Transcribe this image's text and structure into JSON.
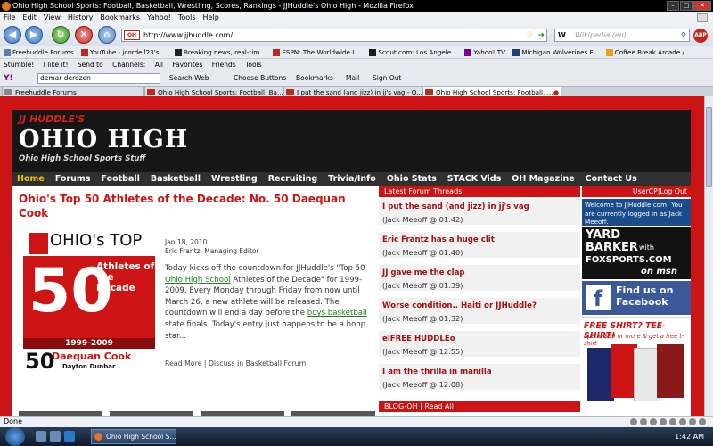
{
  "window": {
    "title": "Ohio High School Sports: Football, Basketball, Wrestling, Scores, Rankings - JJHuddle's Ohio High - Mozilla Firefox"
  },
  "menu": {
    "items": [
      "File",
      "Edit",
      "View",
      "History",
      "Bookmarks",
      "Yahoo!",
      "Tools",
      "Help"
    ]
  },
  "nav": {
    "url": "http://www.jjhuddle.com/",
    "search_placeholder": "Wikipedia (en)",
    "search_engine": "W",
    "abp_label": "ABP"
  },
  "bookmarks": [
    "Freehuddle Forums",
    "YouTube - jcordell23's ...",
    "Breaking news, real-tim...",
    "ESPN: The Worldwide L...",
    "Scout.com: Los Angele...",
    "Yahoo! TV",
    "Michigan Wolverines F...",
    "Coffee Break Arcade / ..."
  ],
  "stumble": {
    "items": [
      "Stumble!",
      "I like it!",
      "Send to",
      "Channels:",
      "All",
      "Favorites",
      "Friends",
      "Tools"
    ]
  },
  "yahoo": {
    "logo": "Y!",
    "query": "demar derozen",
    "search_web": "Search Web",
    "choose_buttons": "Choose Buttons",
    "bookmarks": "Bookmarks",
    "mail": "Mail",
    "sign_out": "Sign Out"
  },
  "tabs": [
    {
      "label": "Freehuddle Forums",
      "active": false
    },
    {
      "label": "Ohio High School Sports: Football, Ba...",
      "active": false
    },
    {
      "label": "I put the sand (and jizz) in jj's vag - O...",
      "active": false
    },
    {
      "label": "Ohio High School Sports: Football, ...",
      "active": true
    }
  ],
  "site": {
    "brand_top": "JJ HUDDLE'S",
    "brand_main": "OHIO HIGH",
    "brand_sub": "Ohio High School Sports Stuff",
    "nav": [
      "Home",
      "Forums",
      "Football",
      "Basketball",
      "Wrestling",
      "Recruiting",
      "Trivia/Info",
      "Ohio Stats",
      "STACK Vids",
      "OH Magazine",
      "Contact Us"
    ]
  },
  "article": {
    "title": "Ohio's Top 50 Athletes of the Decade: No. 50 Daequan Cook",
    "graphic": {
      "top_text": "OHIO's TOP",
      "number": "50",
      "athletes_text": "Athletes of the Decade",
      "years": "1999-2009",
      "player_number": "50",
      "player_name": "Daequan Cook",
      "school": "Dayton Dunbar"
    },
    "date": "Jan 18, 2010",
    "author": "Eric Frantz, Managing Editor",
    "body_1": "Today kicks off the countdown for JJHuddle's \"Top 50 ",
    "body_link1": "Ohio High School",
    "body_2": " Athletes of the Decade\" for 1999-2009. Every Monday through Friday from now until March 26, a new athlete will be released. The countdown will end a day before the ",
    "body_link2": "boys basketball",
    "body_3": " state finals. Today's entry just happens to be a hoop star...",
    "read_more": "Read More",
    "separator": "|",
    "discuss": "Discuss in Basketball Forum"
  },
  "forum": {
    "header": "Latest Forum Threads",
    "threads": [
      {
        "title": "I put the sand (and jizz) in jj's vag",
        "meta": "(Jack Meeoff @ 01:42)"
      },
      {
        "title": "Eric Frantz has a huge clit",
        "meta": "(Jack Meeoff @ 01:40)"
      },
      {
        "title": "JJ gave me the clap",
        "meta": "(Jack Meeoff @ 01:39)"
      },
      {
        "title": "Worse condition.. Haiti or JJHuddle?",
        "meta": "(Jack Meeoff @ 01:32)"
      },
      {
        "title": "elFREE HUDDLEo",
        "meta": "(Jack Meeoff @ 12:55)"
      },
      {
        "title": "I am the thrilla in manilla",
        "meta": "(Jack Meeoff @ 12:08)"
      }
    ],
    "blog_header": "BLOG-OH | Read All"
  },
  "sidebar": {
    "usercp": "UserCP",
    "logout": "Log Out",
    "welcome": "Welcome to JJHuddle.com! You are currently logged in as Jack Meeoff.",
    "yardbarker": "YARD BARKER",
    "with": "with",
    "foxsports": "FOXSPORTS.COM",
    "msn": "on msn",
    "facebook": "Find us on Facebook",
    "free_shirt": "FREE SHIRT? TEE-SHIRT!",
    "free_shirt_sub": "Spend $99 or more & get a free t-shirt"
  },
  "status": {
    "text": "Done"
  },
  "taskbar": {
    "task": "Ohio High School S...",
    "clock": "1:42 AM"
  },
  "colors": {
    "brand_red": "#cc1414",
    "nav_yellow": "#f3c400",
    "link_green": "#208020",
    "facebook_blue": "#3b5998"
  }
}
